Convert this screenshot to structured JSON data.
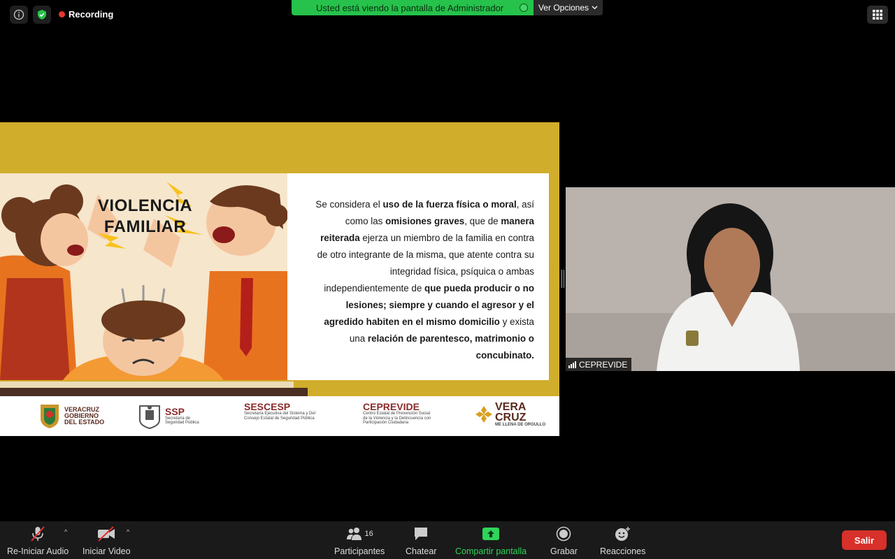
{
  "topbar": {
    "recording_label": "Recording",
    "banner_text": "Usted está viendo la pantalla de Administrador",
    "view_options_label": "Ver Opciones"
  },
  "slide": {
    "title_line1": "VIOLENCIA",
    "title_line2": "FAMILIAR",
    "body": [
      {
        "t": "Se considera el ",
        "b": false
      },
      {
        "t": "uso de la fuerza física o moral",
        "b": true
      },
      {
        "t": ", así como las ",
        "b": false
      },
      {
        "t": "omisiones graves",
        "b": true
      },
      {
        "t": ", que de ",
        "b": false
      },
      {
        "t": "manera reiterada",
        "b": true
      },
      {
        "t": " ejerza un miembro de la familia en contra de otro integrante de la misma, que atente contra su integridad física, psíquica o ambas independientemente de ",
        "b": false
      },
      {
        "t": "que pueda producir o no lesiones; siempre y cuando el agresor y el agredido habiten en el mismo domicilio",
        "b": true
      },
      {
        "t": " y exista una ",
        "b": false
      },
      {
        "t": "relación de parentesco, matrimonio o concubinato.",
        "b": true
      }
    ],
    "logos": {
      "veracruz_line1": "VERACRUZ",
      "veracruz_line2": "GOBIERNO",
      "veracruz_line3": "DEL ESTADO",
      "ssp_name": "SSP",
      "ssp_sub1": "Secretaría de",
      "ssp_sub2": "Seguridad Pública",
      "sescesp_name": "SESCESP",
      "sescesp_sub1": "Secretaría Ejecutiva del Sistema y Del",
      "sescesp_sub2": "Consejo Estatal de Seguridad Pública",
      "ceprevide_name": "CEPREVIDE",
      "ceprevide_sub1": "Centro Estatal de Prevención Social",
      "ceprevide_sub2": "de la Violencia y la Delincuencia con",
      "ceprevide_sub3": "Participación Ciudadana",
      "veracruz2_line1": "VERA",
      "veracruz2_line2": "CRUZ",
      "veracruz2_tag": "ME LLENA DE ORGULLO"
    }
  },
  "video": {
    "participant_name": "CEPREVIDE"
  },
  "toolbar": {
    "audio_label": "Re-Iniciar Audio",
    "video_label": "Iniciar Video",
    "participants_label": "Participantes",
    "participants_count": "16",
    "chat_label": "Chatear",
    "share_label": "Compartir pantalla",
    "record_label": "Grabar",
    "reactions_label": "Reacciones",
    "leave_label": "Salir"
  }
}
